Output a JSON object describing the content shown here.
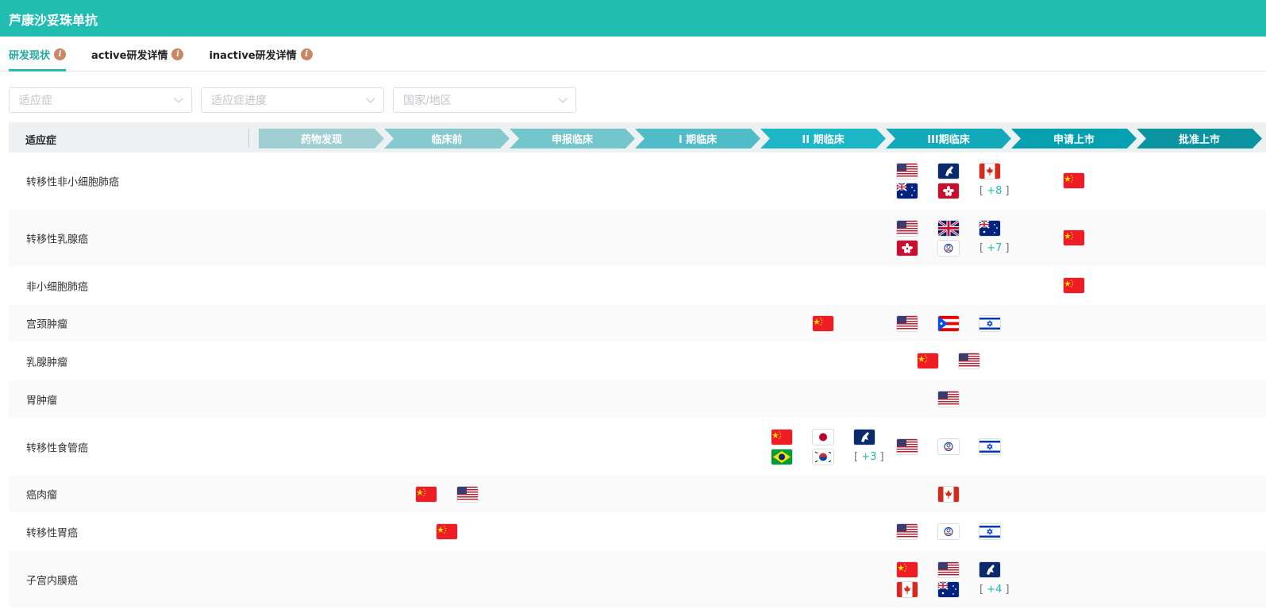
{
  "title": "芦康沙妥珠单抗",
  "tabs": [
    {
      "label": "研发现状",
      "active": true
    },
    {
      "label": "active研发详情",
      "active": false
    },
    {
      "label": "inactive研发详情",
      "active": false
    }
  ],
  "filters": [
    {
      "placeholder": "适应症"
    },
    {
      "placeholder": "适应症进度"
    },
    {
      "placeholder": "国家/地区"
    }
  ],
  "table": {
    "indication_header": "适应症",
    "phases": [
      {
        "label": "药物发现",
        "color": "#9fcfd3"
      },
      {
        "label": "临床前",
        "color": "#86cacf"
      },
      {
        "label": "申报临床",
        "color": "#74c5cc"
      },
      {
        "label": "I 期临床",
        "color": "#4fbcc8"
      },
      {
        "label": "II 期临床",
        "color": "#1db6c7"
      },
      {
        "label": "III期临床",
        "color": "#12a9bb"
      },
      {
        "label": "申请上市",
        "color": "#07a0b0"
      },
      {
        "label": "批准上市",
        "color": "#0b93a0"
      }
    ],
    "rows": [
      {
        "name": "转移性非小细胞肺癌",
        "h": 72,
        "cells": {
          "5": {
            "flags": [
              "us",
              "eu",
              "ca",
              "au",
              "hk"
            ],
            "more": "+8"
          },
          "6": {
            "flags": [
              "cn"
            ]
          }
        }
      },
      {
        "name": "转移性乳腺癌",
        "h": 72,
        "cells": {
          "5": {
            "flags": [
              "us",
              "gb",
              "au",
              "hk",
              "tw"
            ],
            "more": "+7"
          },
          "6": {
            "flags": [
              "cn"
            ]
          }
        }
      },
      {
        "name": "非小细胞肺癌",
        "h": 48,
        "cells": {
          "6": {
            "flags": [
              "cn"
            ]
          }
        }
      },
      {
        "name": "宫颈肿瘤",
        "h": 47,
        "cells": {
          "4": {
            "flags": [
              "cn"
            ]
          },
          "5": {
            "flags": [
              "us",
              "pr",
              "il"
            ]
          }
        }
      },
      {
        "name": "乳腺肿瘤",
        "h": 48,
        "cells": {
          "5": {
            "flags": [
              "cn",
              "us"
            ]
          }
        }
      },
      {
        "name": "胃肿瘤",
        "h": 48,
        "cells": {
          "5": {
            "flags": [
              "us"
            ]
          }
        }
      },
      {
        "name": "转移性食管癌",
        "h": 72,
        "cells": {
          "4": {
            "flags": [
              "cn",
              "jp",
              "eu",
              "br",
              "kr"
            ],
            "more": "+3"
          },
          "5": {
            "flags": [
              "us",
              "tw",
              "il"
            ]
          }
        }
      },
      {
        "name": "癌肉瘤",
        "h": 47,
        "cells": {
          "1": {
            "flags": [
              "cn",
              "us"
            ]
          },
          "5": {
            "flags": [
              "ca"
            ]
          }
        }
      },
      {
        "name": "转移性胃癌",
        "h": 48,
        "cells": {
          "1": {
            "flags": [
              "cn"
            ]
          },
          "5": {
            "flags": [
              "us",
              "tw",
              "il"
            ]
          }
        }
      },
      {
        "name": "子宫内膜癌",
        "h": 72,
        "cells": {
          "5": {
            "flags": [
              "cn",
              "us",
              "eu",
              "ca",
              "au"
            ],
            "more": "+4"
          }
        }
      }
    ]
  }
}
